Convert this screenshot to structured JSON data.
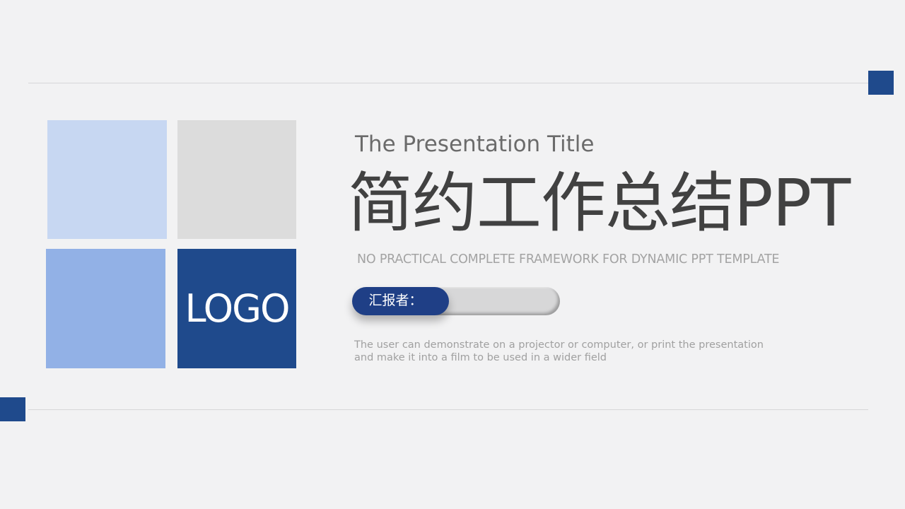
{
  "slide": {
    "logo_text": "LOGO",
    "subtitle": "The Presentation Title",
    "main_title": "简约工作总结PPT",
    "framework_text": "NO PRACTICAL COMPLETE FRAMEWORK FOR DYNAMIC PPT TEMPLATE",
    "reporter_label": "汇报者：",
    "description_line1": "The user can demonstrate on a projector or computer, or print the presentation",
    "description_line2": "and make it into a film to be used in a wider field"
  },
  "colors": {
    "background": "#f2f2f3",
    "accent_dark_blue": "#1f4a8c",
    "tile_light_blue": "#c7d7f2",
    "tile_gray": "#dcdcdc",
    "tile_mid_blue": "#92b1e6",
    "tile_logo_blue": "#1f4a8c",
    "title_text": "#414141",
    "muted_text": "#a3a3a3"
  }
}
